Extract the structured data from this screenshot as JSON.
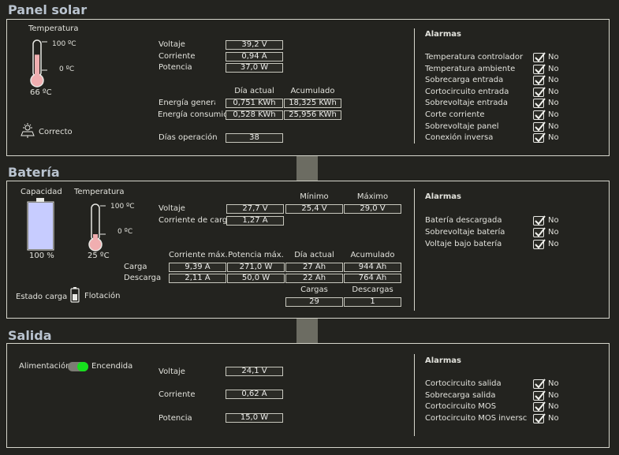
{
  "solar": {
    "title": "Panel solar",
    "temp_label": "Temperatura",
    "temp_max": "100 ºC",
    "temp_min": "0 ºC",
    "temp_value": "66 ºC",
    "temp_level": 0.66,
    "status": "Correcto",
    "voltage_label": "Voltaje",
    "voltage": "39,2 V",
    "current_label": "Corriente",
    "current": "0,94 A",
    "power_label": "Potencia",
    "power": "37,0 W",
    "col_day": "Día actual",
    "col_acc": "Acumulado",
    "gen_label": "Energía generai",
    "gen_day": "0,751 KWh",
    "gen_acc": "18,325 KWh",
    "cons_label": "Energía consumida",
    "cons_day": "0,528 KWh",
    "cons_acc": "25,956 KWh",
    "days_label": "Días operación",
    "days": "38"
  },
  "solar_alarms": {
    "title": "Alarmas",
    "items": [
      {
        "label": "Temperatura controlador",
        "value": "No"
      },
      {
        "label": "Temperatura ambiente",
        "value": "No"
      },
      {
        "label": "Sobrecarga entrada",
        "value": "No"
      },
      {
        "label": "Cortocircuito entrada",
        "value": "No"
      },
      {
        "label": "Sobrevoltaje entrada",
        "value": "No"
      },
      {
        "label": "Corte corriente",
        "value": "No"
      },
      {
        "label": "Sobrevoltaje panel",
        "value": "No"
      },
      {
        "label": "Conexión inversa",
        "value": "No"
      }
    ]
  },
  "battery": {
    "title": "Batería",
    "capacity_label": "Capacidad",
    "capacity_value": "100 %",
    "capacity_level": 1.0,
    "temp_label": "Temperatura",
    "temp_max": "100 ºC",
    "temp_min": "0 ºC",
    "temp_value": "25 ºC",
    "temp_level": 0.25,
    "col_min": "Mínimo",
    "col_max": "Máximo",
    "voltage_label": "Voltaje",
    "voltage": "27,7 V",
    "voltage_min": "25,4 V",
    "voltage_max": "29,0 V",
    "charge_current_label": "Corriente de carga",
    "charge_current": "1,27 A",
    "col_imax": "Corriente máx.",
    "col_pmax": "Potencia máx.",
    "col_day": "Día actual",
    "col_acc": "Acumulado",
    "carga_label": "Carga",
    "carga_imax": "9,39 A",
    "carga_pmax": "271,0 W",
    "carga_day": "27 Ah",
    "carga_acc": "944 Ah",
    "descarga_label": "Descarga",
    "descarga_imax": "2,11 A",
    "descarga_pmax": "50,0 W",
    "descarga_day": "22 Ah",
    "descarga_acc": "764 Ah",
    "col_cargas": "Cargas",
    "col_descargas": "Descargas",
    "cargas": "29",
    "descargas": "1",
    "state_label": "Estado carga",
    "state_value": "Flotación"
  },
  "battery_alarms": {
    "title": "Alarmas",
    "items": [
      {
        "label": "Batería descargada",
        "value": "No"
      },
      {
        "label": "Sobrevoltaje batería",
        "value": "No"
      },
      {
        "label": "Voltaje bajo batería",
        "value": "No"
      }
    ]
  },
  "output": {
    "title": "Salida",
    "power_switch_label": "Alimentación",
    "power_switch_state": "Encendida",
    "voltage_label": "Voltaje",
    "voltage": "24,1 V",
    "current_label": "Corriente",
    "current": "0,62 A",
    "power_label": "Potencia",
    "power": "15,0 W"
  },
  "output_alarms": {
    "title": "Alarmas",
    "items": [
      {
        "label": "Cortocircuito salida",
        "value": "No"
      },
      {
        "label": "Sobrecarga salida",
        "value": "No"
      },
      {
        "label": "Cortocircuito MOS",
        "value": "No"
      },
      {
        "label": "Cortocircuito MOS inversc",
        "value": "No"
      }
    ]
  },
  "colors": {
    "background": "#23231f",
    "title": "#b9c3cf",
    "thermo_fill": "#f0aeb0",
    "battery_fill": "#c7ccff",
    "switch_on": "#16e01d"
  }
}
